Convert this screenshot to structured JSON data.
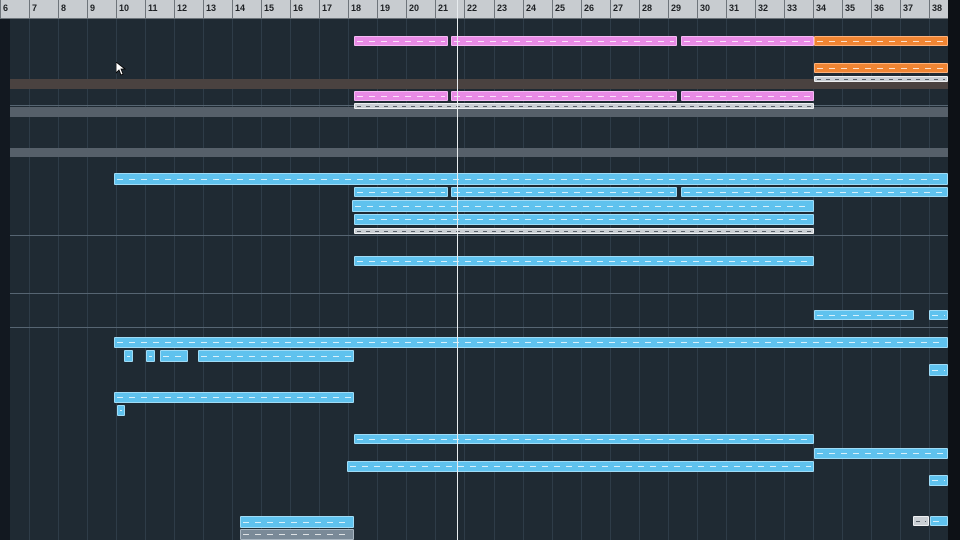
{
  "ruler": {
    "bars": [
      "6",
      "7",
      "8",
      "9",
      "10",
      "11",
      "12",
      "13",
      "14",
      "15",
      "16",
      "17",
      "18",
      "19",
      "20",
      "21",
      "22",
      "23",
      "24",
      "25",
      "26",
      "27",
      "28",
      "29",
      "30",
      "31",
      "32",
      "33",
      "34",
      "35",
      "36",
      "37",
      "38"
    ]
  },
  "colors": {
    "ruler_bg": "#c8ccd0",
    "arrange_bg": "#1f2a33",
    "clip_blue": "#5fc2ee",
    "clip_pink": "#e98be6",
    "clip_orange": "#f08533",
    "clip_gray": "#c9ced3",
    "playhead": "#e8ecef"
  },
  "icons": {
    "cursor": "mouse-pointer-icon"
  }
}
